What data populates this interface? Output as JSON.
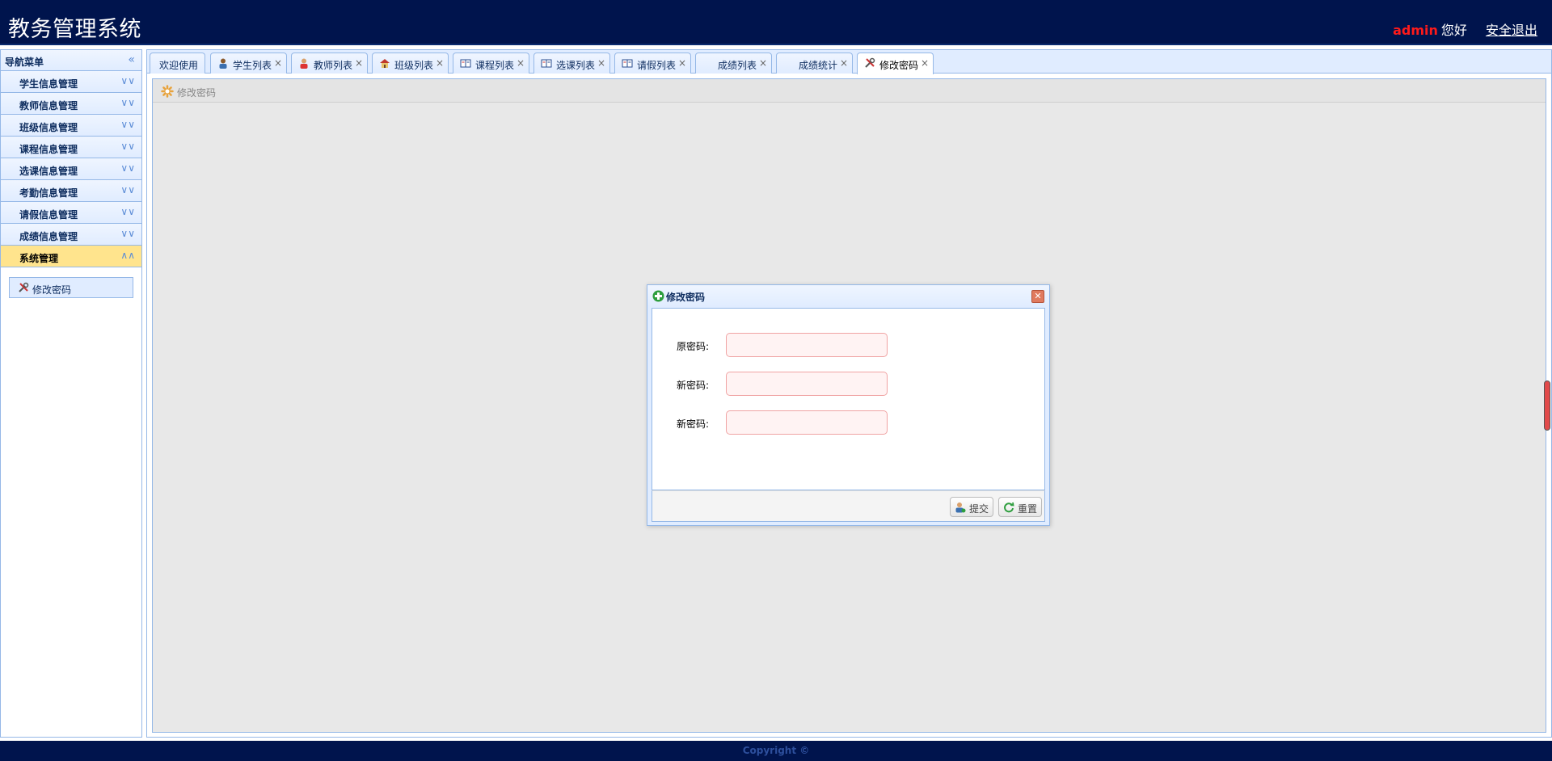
{
  "header": {
    "app_title": "教务管理系统",
    "user_name": "admin",
    "greeting": "您好",
    "logout_label": "安全退出"
  },
  "nav": {
    "title": "导航菜单",
    "collapse_icon": "double-chevron-left-icon",
    "sections": [
      {
        "label": "学生信息管理",
        "expanded": false
      },
      {
        "label": "教师信息管理",
        "expanded": false
      },
      {
        "label": "班级信息管理",
        "expanded": false
      },
      {
        "label": "课程信息管理",
        "expanded": false
      },
      {
        "label": "选课信息管理",
        "expanded": false
      },
      {
        "label": "考勤信息管理",
        "expanded": false
      },
      {
        "label": "请假信息管理",
        "expanded": false
      },
      {
        "label": "成绩信息管理",
        "expanded": false
      },
      {
        "label": "系统管理",
        "expanded": true
      }
    ],
    "system_items": [
      {
        "label": "修改密码",
        "icon": "tools-icon"
      }
    ]
  },
  "tabs": [
    {
      "label": "欢迎使用",
      "icon": "",
      "closable": false,
      "active": false
    },
    {
      "label": "学生列表",
      "icon": "user-icon",
      "closable": true,
      "active": false
    },
    {
      "label": "教师列表",
      "icon": "user-red-icon",
      "closable": true,
      "active": false
    },
    {
      "label": "班级列表",
      "icon": "house-icon",
      "closable": true,
      "active": false
    },
    {
      "label": "课程列表",
      "icon": "book-icon",
      "closable": true,
      "active": false
    },
    {
      "label": "选课列表",
      "icon": "book-icon",
      "closable": true,
      "active": false
    },
    {
      "label": "请假列表",
      "icon": "book-icon",
      "closable": true,
      "active": false
    },
    {
      "label": "成绩列表",
      "icon": "",
      "closable": true,
      "active": false
    },
    {
      "label": "成绩统计",
      "icon": "",
      "closable": true,
      "active": false
    },
    {
      "label": "修改密码",
      "icon": "tools-icon",
      "closable": true,
      "active": true
    }
  ],
  "tab_close_glyph": "×",
  "panel": {
    "title": "修改密码"
  },
  "dialog": {
    "title": "修改密码",
    "fields": [
      {
        "label": "原密码:",
        "value": "",
        "placeholder": ""
      },
      {
        "label": "新密码:",
        "value": "",
        "placeholder": ""
      },
      {
        "label": "新密码:",
        "value": "",
        "placeholder": ""
      }
    ],
    "submit_label": "提交",
    "reset_label": "重置"
  },
  "footer": {
    "copyright": "Copyright ©"
  },
  "colors": {
    "header_bg": "#00144d",
    "username_red": "#ff1a1a",
    "active_section_bg": "#ffe48d",
    "border_blue": "#95b8e7"
  }
}
